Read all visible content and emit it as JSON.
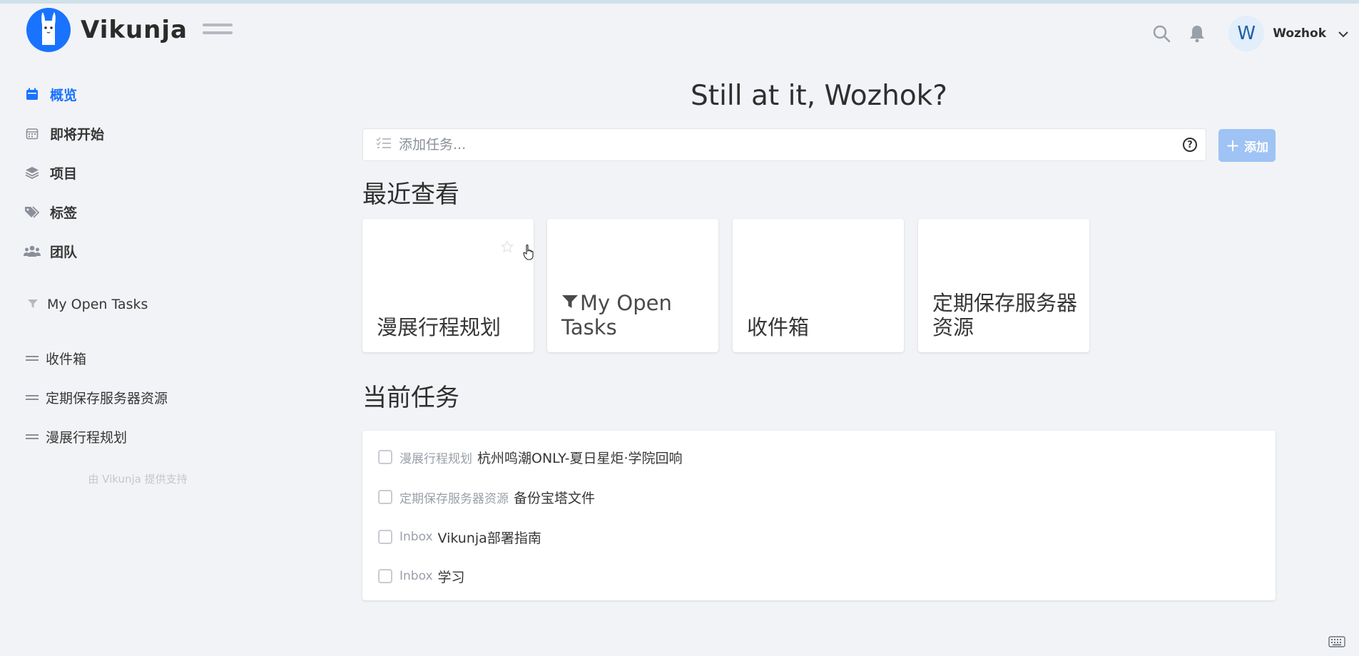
{
  "app": {
    "name": "Vikunja"
  },
  "header": {
    "user": {
      "initial": "W",
      "name": "Wozhok"
    },
    "icons": {
      "search": "search-icon",
      "bell": "bell-icon",
      "menu": "hamburger-icon",
      "caret": "chevron-down-icon"
    }
  },
  "sidebar": {
    "nav": [
      {
        "label": "概览",
        "icon": "calendar-icon",
        "active": true
      },
      {
        "label": "即将开始",
        "icon": "calendar-grid-icon",
        "active": false
      },
      {
        "label": "项目",
        "icon": "layers-icon",
        "active": false
      },
      {
        "label": "标签",
        "icon": "tags-icon",
        "active": false
      },
      {
        "label": "团队",
        "icon": "users-icon",
        "active": false
      }
    ],
    "saved_filter": {
      "label": "My Open Tasks",
      "icon": "filter-icon"
    },
    "projects": [
      {
        "label": "收件箱"
      },
      {
        "label": "定期保存服务器资源"
      },
      {
        "label": "漫展行程规划"
      }
    ],
    "powered_by": "由 Vikunja 提供支持"
  },
  "main": {
    "greeting": "Still at it, Wozhok?",
    "add_task": {
      "placeholder": "添加任务...",
      "button_label": "添加",
      "help": "?"
    },
    "recent_title": "最近查看",
    "recent_cards": [
      {
        "title": "漫展行程规划"
      },
      {
        "title": "My Open Tasks",
        "icon": "filter-icon"
      },
      {
        "title": "收件箱"
      },
      {
        "title": "定期保存服务器资源"
      }
    ],
    "current_title": "当前任务",
    "tasks": [
      {
        "project": "漫展行程规划",
        "title": "杭州鸣潮ONLY-夏日星炬·学院回响"
      },
      {
        "project": "定期保存服务器资源",
        "title": "备份宝塔文件"
      },
      {
        "project": "Inbox",
        "title": "Vikunja部署指南"
      },
      {
        "project": "Inbox",
        "title": "学习"
      }
    ]
  },
  "colors": {
    "accent": "#1973ff",
    "add_button": "#9ec3f4",
    "background": "#f2f3f6"
  }
}
